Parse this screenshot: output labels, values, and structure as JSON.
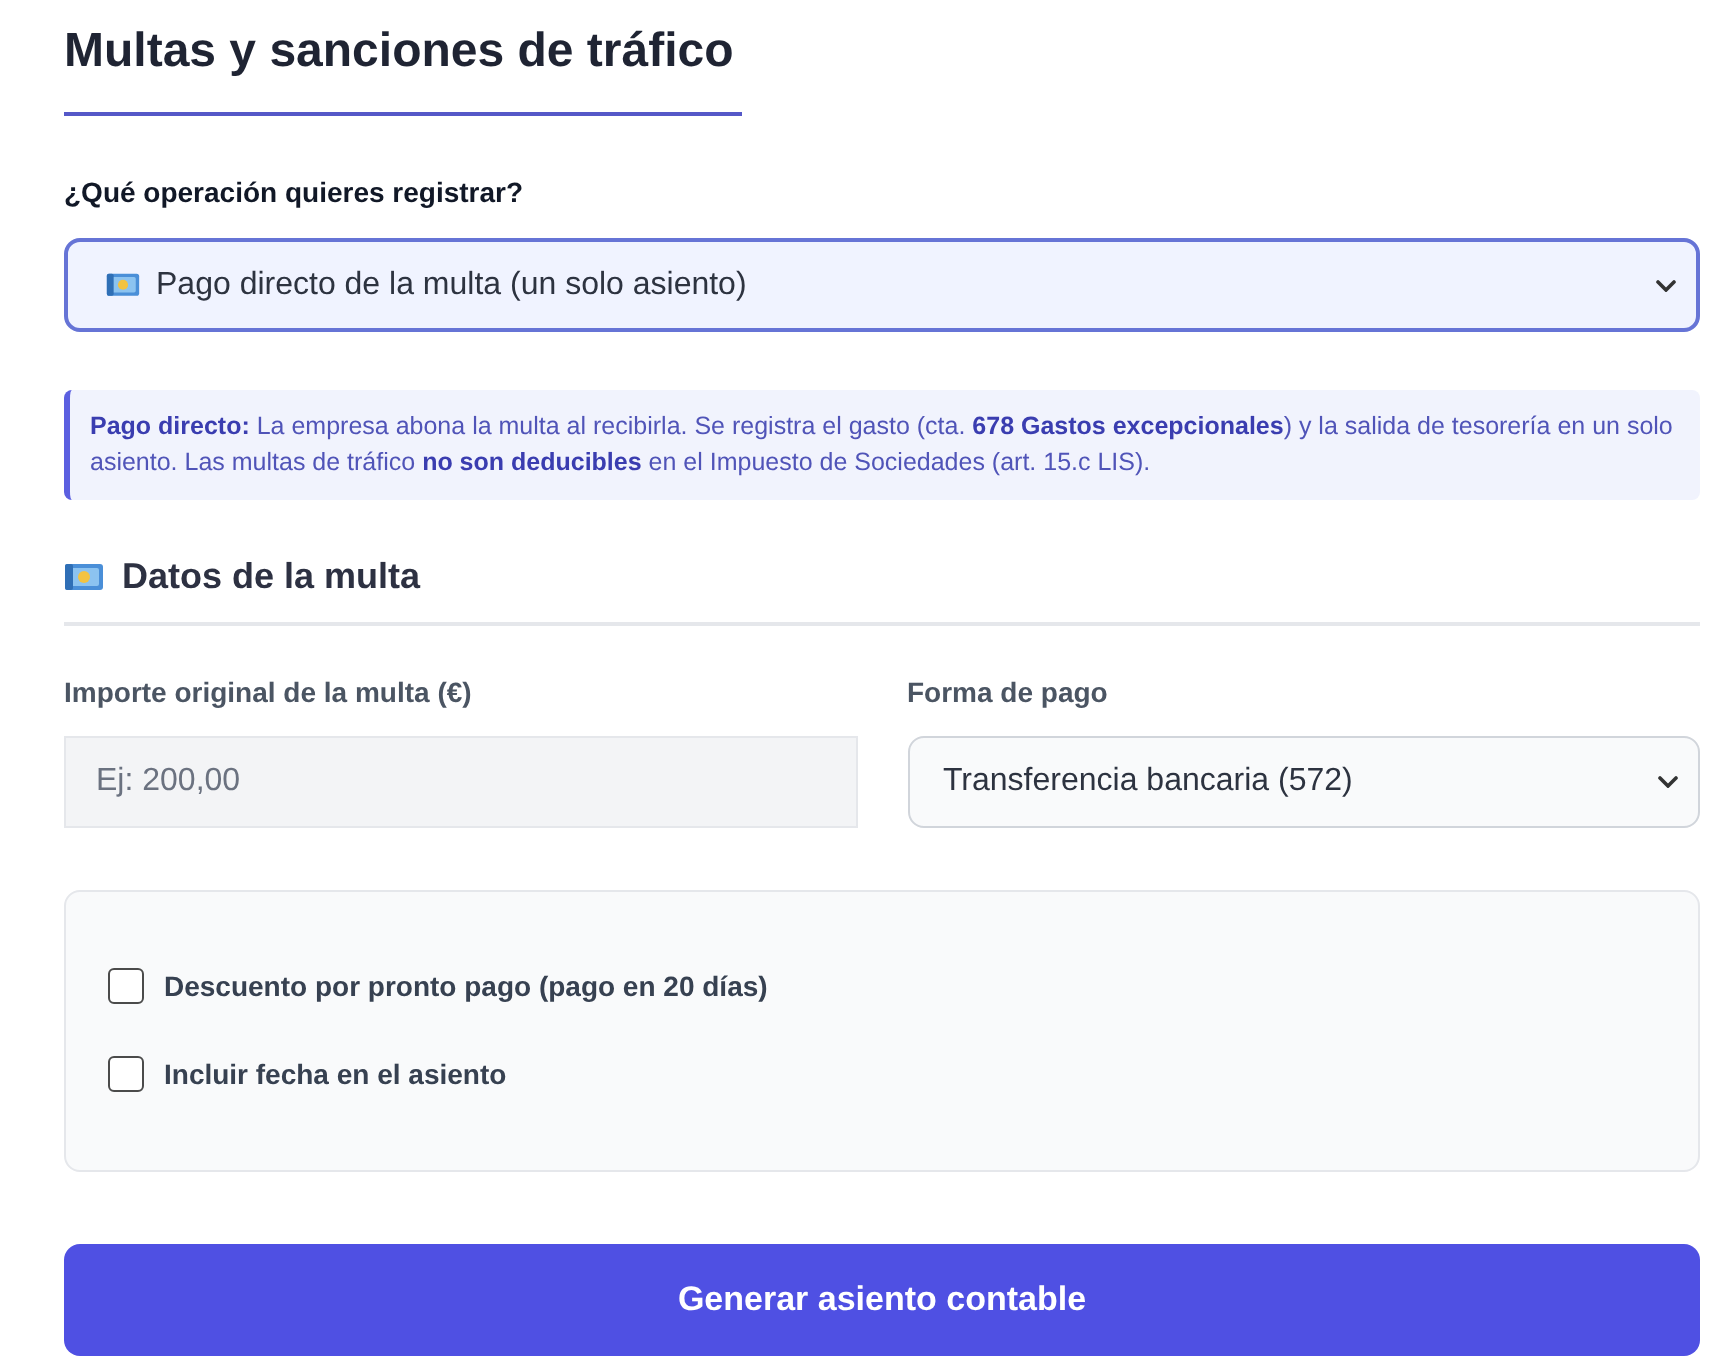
{
  "page": {
    "title": "Multas y sanciones de tráfico"
  },
  "operation": {
    "label": "¿Qué operación quieres registrar?",
    "value": "Pago directo de la multa (un solo asiento)"
  },
  "info": {
    "text": "**Pago directo:** La empresa abona la multa al recibirla. Se registra el gasto (cta. **678 Gastos excepcionales**) y la salida de tesorería en un solo asiento. Las multas de tráfico **no son deducibles** en el Impuesto de Sociedades (art. 15.c LIS)."
  },
  "section": {
    "title": "Datos de la multa"
  },
  "fields": [
    {
      "kind": "input",
      "label": "Importe original de la multa (€)",
      "placeholder": "Ej: 200,00"
    },
    {
      "kind": "select",
      "label": "Forma de pago",
      "value": "Transferencia bancaria (572)"
    }
  ],
  "options": [
    {
      "label": "Descuento por pronto pago (pago en 20 días)",
      "checked": false
    },
    {
      "label": "Incluir fecha en el asiento",
      "checked": false
    }
  ],
  "submit": {
    "label": "Generar asiento contable"
  }
}
